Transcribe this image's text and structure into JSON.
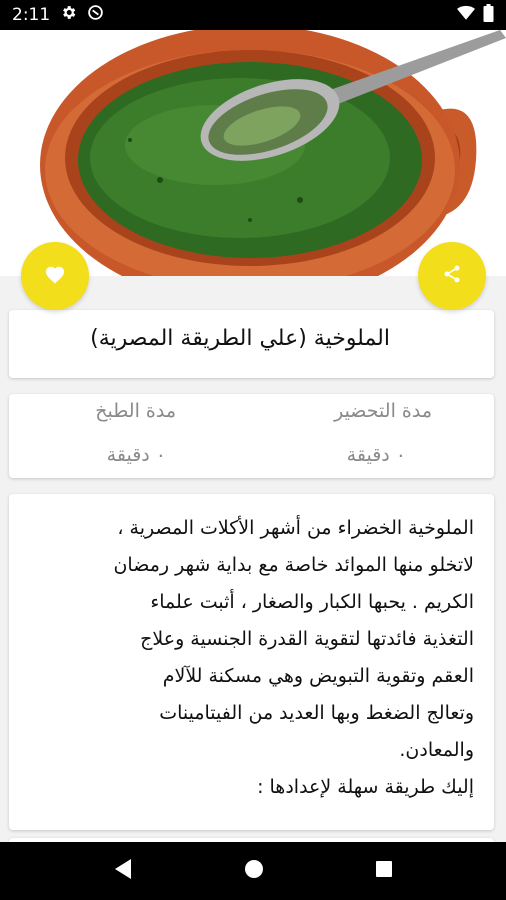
{
  "status_bar": {
    "time": "2:11",
    "icons_left": [
      "gear-icon",
      "do-not-disturb-icon"
    ],
    "icons_right": [
      "wifi-icon",
      "battery-icon"
    ]
  },
  "hero": {
    "image": "molokhia-soup-in-clay-pot-with-spoon"
  },
  "actions": {
    "favorite_icon": "heart-icon",
    "share_icon": "share-icon",
    "accent": "#f2de1b"
  },
  "recipe": {
    "title": "الملوخية (علي الطريقة المصرية)",
    "prep_label": "مدة التحضير",
    "prep_value": "٠ دقيقة",
    "cook_label": "مدة الطبخ",
    "cook_value": "٠ دقيقة",
    "description_lines": [
      "الملوخية الخضراء من أشهر الأكلات المصرية ،",
      "لاتخلو منها الموائد خاصة مع بداية شهر رمضان",
      "الكريم . يحبها الكبار والصغار ، أثبت علماء",
      "التغذية فائدتها لتقوية القدرة الجنسية وعلاج",
      "العقم وتقوية التبويض وهي مسكنة للآلام",
      "وتعالج الضغط وبها العديد من الفيتامينات",
      "والمعادن.",
      "إليك طريقة سهلة لإعدادها :"
    ]
  },
  "nav_bar": {
    "icons": [
      "back-icon",
      "home-icon",
      "recents-icon"
    ]
  }
}
